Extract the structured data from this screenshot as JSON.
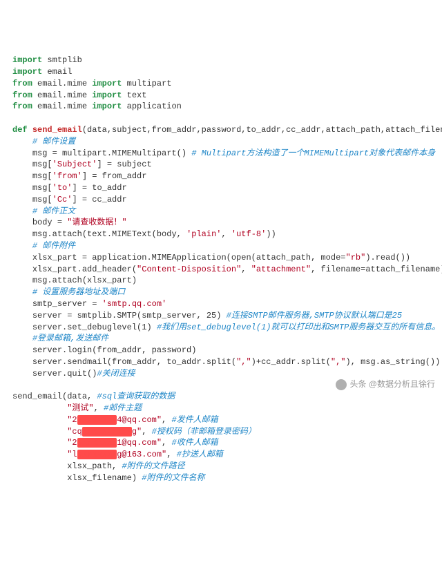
{
  "code": {
    "l1": {
      "kw1": "import",
      "p1": " smtplib"
    },
    "l2": {
      "kw1": "import",
      "p1": " email"
    },
    "l3": {
      "kw1": "from",
      "p1": " email.mime ",
      "kw2": "import",
      "p2": " multipart"
    },
    "l4": {
      "kw1": "from",
      "p1": " email.mime ",
      "kw2": "import",
      "p2": " text"
    },
    "l5": {
      "kw1": "from",
      "p1": " email.mime ",
      "kw2": "import",
      "p2": " application"
    },
    "l6": {
      "kw1": "def ",
      "fn": "send_email",
      "sig": "(data,subject,from_addr,password,to_addr,cc_addr,attach_path,attach_filename):"
    },
    "l7": {
      "indent": "    ",
      "cm": "# 邮件设置"
    },
    "l8": {
      "indent": "    ",
      "p1": "msg = multipart.MIMEMultipart() ",
      "cm": "# Multipart方法构造了一个MIMEMultipart对象代表邮件本身"
    },
    "l9": {
      "indent": "    ",
      "p1": "msg[",
      "s1": "'Subject'",
      "p2": "] = subject"
    },
    "l10": {
      "indent": "    ",
      "p1": "msg[",
      "s1": "'from'",
      "p2": "] = from_addr"
    },
    "l11": {
      "indent": "    ",
      "p1": "msg[",
      "s1": "'to'",
      "p2": "] = to_addr"
    },
    "l12": {
      "indent": "    ",
      "p1": "msg[",
      "s1": "'Cc'",
      "p2": "] = cc_addr"
    },
    "l13": {
      "indent": "    ",
      "cm": "# 邮件正文"
    },
    "l14": {
      "indent": "    ",
      "p1": "body = ",
      "s1": "\"请查收数据！\""
    },
    "l15": {
      "indent": "    ",
      "p1": "msg.attach(text.MIMEText(body, ",
      "s1": "'plain'",
      "p2": ", ",
      "s2": "'utf-8'",
      "p3": "))"
    },
    "l16": {
      "indent": "    ",
      "cm": "# 邮件附件"
    },
    "l17": {
      "indent": "    ",
      "p1": "xlsx_part = application.MIMEApplication(open(attach_path, mode=",
      "s1": "\"rb\"",
      "p2": ").read())"
    },
    "l18": {
      "indent": "    ",
      "p1": "xlsx_part.add_header(",
      "s1": "\"Content-Disposition\"",
      "p2": ", ",
      "s2": "\"attachment\"",
      "p3": ", filename=attach_filename)"
    },
    "l19": {
      "indent": "    ",
      "p1": "msg.attach(xlsx_part)"
    },
    "l20": {
      "indent": "    ",
      "cm": "# 设置服务器地址及端口"
    },
    "l21": {
      "indent": "    ",
      "p1": "smtp_server = ",
      "s1": "'smtp.qq.com'"
    },
    "l22": {
      "indent": "    ",
      "p1": "server = smtplib.SMTP(smtp_server, 25) ",
      "cm": "#连接SMTP邮件服务器,SMTP协议默认端口是25"
    },
    "l23": {
      "indent": "    ",
      "p1": "server.set_debuglevel(1) ",
      "cm": "#我们用set_debuglevel(1)就可以打印出和SMTP服务器交互的所有信息。"
    },
    "l24": {
      "indent": "    ",
      "cm": "#登录邮箱,发送邮件"
    },
    "l25": {
      "indent": "    ",
      "p1": "server.login(from_addr, password)"
    },
    "l26": {
      "indent": "    ",
      "p1": "server.sendmail(from_addr, to_addr.split(",
      "s1": "\",\"",
      "p2": ")+cc_addr.split(",
      "s2": "\",\"",
      "p3": "), msg.as_string())"
    },
    "l27": {
      "indent": "    ",
      "p1": "server.quit()",
      "cm": "#关闭连接"
    },
    "call": {
      "head": {
        "p1": "send_email(data, ",
        "cm": "#sql查询获取的数据"
      },
      "a1": {
        "s1": "\"测试\"",
        "p1": ", ",
        "cm": "#邮件主题"
      },
      "a2": {
        "s1": "\"2",
        "red": "xxxxxxxx",
        "s2": "4@qq.com\"",
        "p1": ", ",
        "cm": "#发件人邮箱"
      },
      "a3": {
        "s1": "\"cq",
        "red": "xxxxxxxxxx",
        "s2": "g\"",
        "p1": ", ",
        "cm": "#授权码（非邮箱登录密码）"
      },
      "a4": {
        "s1": "\"2",
        "red": "xxxxxxxx",
        "s2": "1@qq.com\"",
        "p1": ", ",
        "cm": "#收件人邮箱"
      },
      "a5": {
        "s1": "\"l",
        "red": "xxxxxxxx",
        "s2": "g@163.com\"",
        "p1": ", ",
        "cm": "#抄送人邮箱"
      },
      "a6": {
        "p1": "xlsx_path, ",
        "cm": "#附件的文件路径"
      },
      "a7": {
        "p1": "xlsx_filename) ",
        "cm": "#附件的文件名称"
      }
    }
  },
  "watermark": "头条 @数据分析且徐行"
}
